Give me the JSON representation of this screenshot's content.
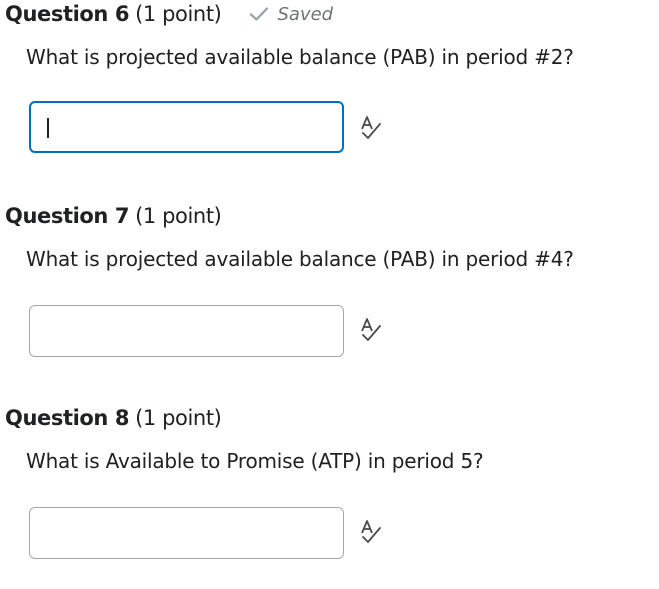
{
  "questions": [
    {
      "title": "Question 6",
      "points": "(1 point)",
      "saved": "Saved",
      "prompt": "What is projected available balance (PAB) in period #2?",
      "answer": ""
    },
    {
      "title": "Question 7",
      "points": "(1 point)",
      "prompt": "What is projected available balance (PAB) in period #4?",
      "answer": ""
    },
    {
      "title": "Question 8",
      "points": "(1 point)",
      "prompt": "What is Available to Promise (ATP) in period 5?",
      "answer": ""
    }
  ],
  "icons": {
    "saved": "checkmark-icon",
    "spell": "spell-check-icon"
  },
  "colors": {
    "focus_border": "#006fbf",
    "input_border": "#a5a8ab",
    "saved_text": "#6e7376",
    "text": "#202122"
  }
}
